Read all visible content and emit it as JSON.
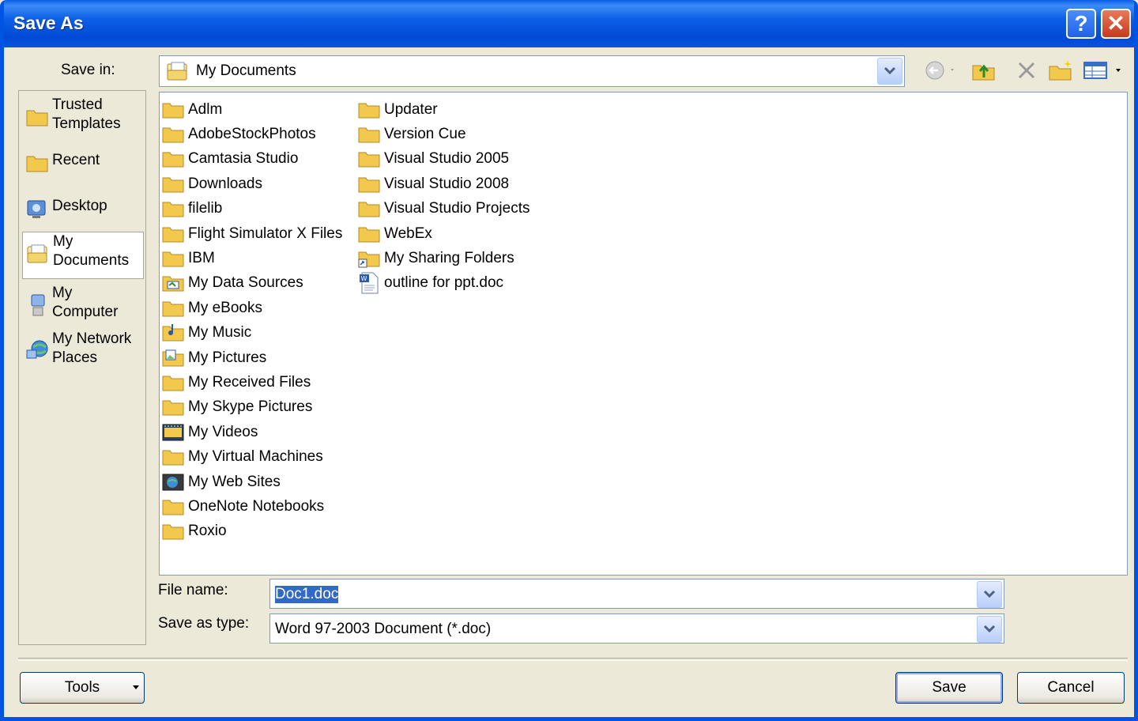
{
  "window": {
    "title": "Save As",
    "help_label": "?",
    "close_label": "✕"
  },
  "toolbar": {
    "save_in_label": "Save in:",
    "save_in_value": "My Documents",
    "icons": [
      "back-icon",
      "up-folder-icon",
      "delete-icon",
      "new-folder-icon",
      "views-icon"
    ]
  },
  "places": [
    {
      "label_line1": "Trusted",
      "label_line2": "Templates",
      "icon": "folder-icon"
    },
    {
      "label_line1": "Recent",
      "label_line2": "",
      "icon": "folder-icon"
    },
    {
      "label_line1": "Desktop",
      "label_line2": "",
      "icon": "desktop-icon"
    },
    {
      "label_line1": "My",
      "label_line2": "Documents",
      "icon": "documents-icon"
    },
    {
      "label_line1": "My",
      "label_line2": "Computer",
      "icon": "computer-icon"
    },
    {
      "label_line1": "My Network",
      "label_line2": "Places",
      "icon": "network-icon"
    }
  ],
  "files": {
    "column1": [
      "Adlm",
      "AdobeStockPhotos",
      "Camtasia Studio",
      "Downloads",
      "filelib",
      "Flight Simulator X Files",
      "IBM",
      "My Data Sources",
      "My eBooks",
      "My Music",
      "My Pictures",
      "My Received Files",
      "My Skype Pictures",
      "My Videos",
      "My Virtual Machines",
      "My Web Sites",
      "OneNote Notebooks",
      "Roxio"
    ],
    "column2": [
      "Updater",
      "Version Cue",
      "Visual Studio 2005",
      "Visual Studio 2008",
      "Visual Studio Projects",
      "WebEx",
      "My Sharing Folders",
      "outline for ppt.doc"
    ]
  },
  "form": {
    "file_name_label": "File name:",
    "file_name_value": "Doc1.doc",
    "save_type_label": "Save as type:",
    "save_type_value": "Word 97-2003 Document (*.doc)"
  },
  "buttons": {
    "tools": "Tools",
    "save": "Save",
    "cancel": "Cancel"
  },
  "colors": {
    "titlebar": "#0054e3",
    "dialog_bg": "#ece9d8",
    "selection": "#316ac5"
  }
}
